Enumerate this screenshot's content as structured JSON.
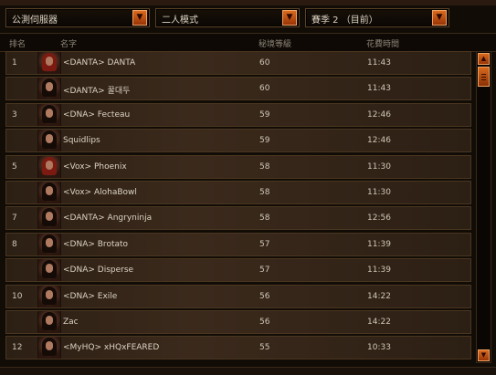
{
  "filters": {
    "region": "公測伺服器",
    "mode": "二人模式",
    "season": "賽季 2 （目前）"
  },
  "columns": {
    "rank": "排名",
    "name": "名字",
    "level": "秘境等級",
    "time": "花費時間"
  },
  "rows": [
    {
      "rank": "1",
      "name": "<DANTA> DANTA",
      "level": "60",
      "time": "11:43",
      "portrait": "red-hair"
    },
    {
      "rank": "",
      "name": "<DANTA> 꿀대두",
      "level": "60",
      "time": "11:43",
      "portrait": "dark-hair"
    },
    {
      "rank": "3",
      "name": "<DNA> Fecteau",
      "level": "59",
      "time": "12:46",
      "portrait": "dark-hair"
    },
    {
      "rank": "",
      "name": "Squidlips",
      "level": "59",
      "time": "12:46",
      "portrait": "dark-hair"
    },
    {
      "rank": "5",
      "name": "<Vox> Phoenix",
      "level": "58",
      "time": "11:30",
      "portrait": "red-hair"
    },
    {
      "rank": "",
      "name": "<Vox> AlohaBowl",
      "level": "58",
      "time": "11:30",
      "portrait": "dark-hair"
    },
    {
      "rank": "7",
      "name": "<DANTA> Angryninja",
      "level": "58",
      "time": "12:56",
      "portrait": "dark-hair"
    },
    {
      "rank": "8",
      "name": "<DNA> Brotato",
      "level": "57",
      "time": "11:39",
      "portrait": "dark-hair"
    },
    {
      "rank": "",
      "name": "<DNA> Disperse",
      "level": "57",
      "time": "11:39",
      "portrait": "dark-hair"
    },
    {
      "rank": "10",
      "name": "<DNA> Exile",
      "level": "56",
      "time": "14:22",
      "portrait": "dark-hair"
    },
    {
      "rank": "",
      "name": "Zac",
      "level": "56",
      "time": "14:22",
      "portrait": "dark-hair"
    },
    {
      "rank": "12",
      "name": "<MyHQ> xHQxFEARED",
      "level": "55",
      "time": "10:33",
      "portrait": "dark-hair"
    }
  ]
}
